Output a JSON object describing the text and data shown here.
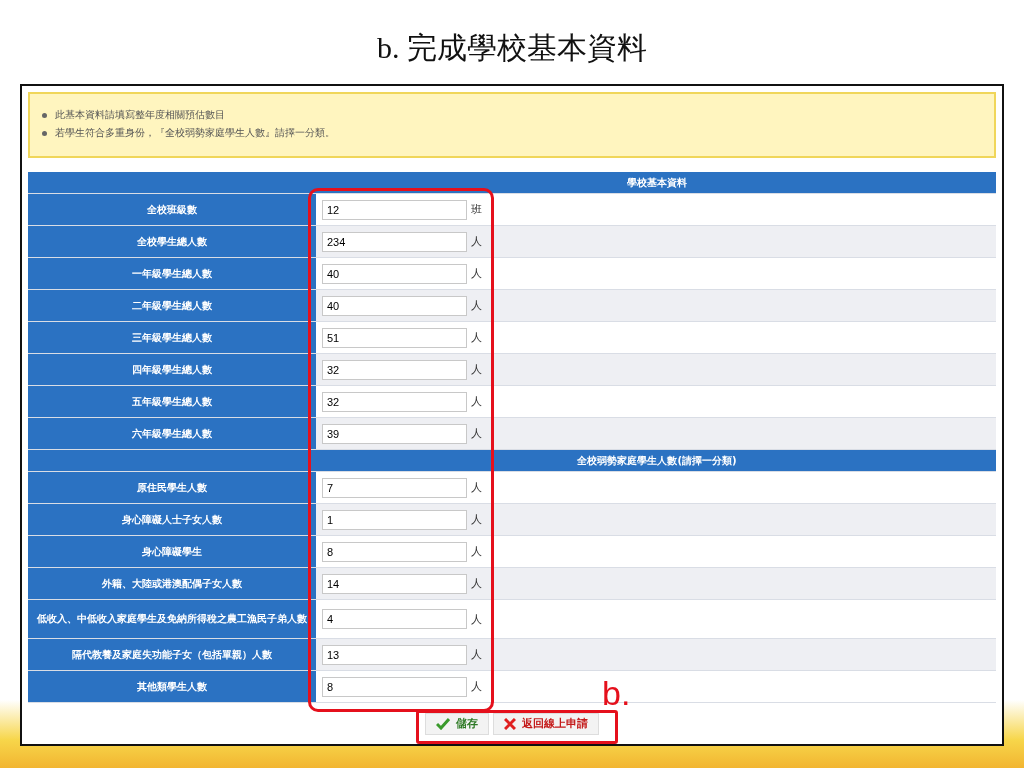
{
  "slide_title": "b. 完成學校基本資料",
  "notice": [
    "此基本資料請填寫整年度相關預估數目",
    "若學生符合多重身份，『全校弱勢家庭學生人數』請擇一分類。"
  ],
  "sections": [
    {
      "heading": "學校基本資料",
      "rows": [
        {
          "label": "全校班級數",
          "value": "12",
          "unit": "班"
        },
        {
          "label": "全校學生總人數",
          "value": "234",
          "unit": "人"
        },
        {
          "label": "一年級學生總人數",
          "value": "40",
          "unit": "人"
        },
        {
          "label": "二年級學生總人數",
          "value": "40",
          "unit": "人"
        },
        {
          "label": "三年級學生總人數",
          "value": "51",
          "unit": "人"
        },
        {
          "label": "四年級學生總人數",
          "value": "32",
          "unit": "人"
        },
        {
          "label": "五年級學生總人數",
          "value": "32",
          "unit": "人"
        },
        {
          "label": "六年級學生總人數",
          "value": "39",
          "unit": "人"
        }
      ]
    },
    {
      "heading": "全校弱勢家庭學生人數(請擇一分類)",
      "rows": [
        {
          "label": "原住民學生人數",
          "value": "7",
          "unit": "人"
        },
        {
          "label": "身心障礙人士子女人數",
          "value": "1",
          "unit": "人"
        },
        {
          "label": "身心障礙學生",
          "value": "8",
          "unit": "人"
        },
        {
          "label": "外籍、大陸或港澳配偶子女人數",
          "value": "14",
          "unit": "人"
        },
        {
          "label": "低收入、中低收入家庭學生及免納所得稅之農工漁民子弟人數",
          "value": "4",
          "unit": "人"
        },
        {
          "label": "隔代教養及家庭失功能子女（包括單親）人數",
          "value": "13",
          "unit": "人"
        },
        {
          "label": "其他類學生人數",
          "value": "8",
          "unit": "人"
        }
      ]
    }
  ],
  "buttons": [
    {
      "label": "儲存",
      "kind": "save"
    },
    {
      "label": "返回線上申請",
      "kind": "back"
    }
  ],
  "annotation": "b."
}
